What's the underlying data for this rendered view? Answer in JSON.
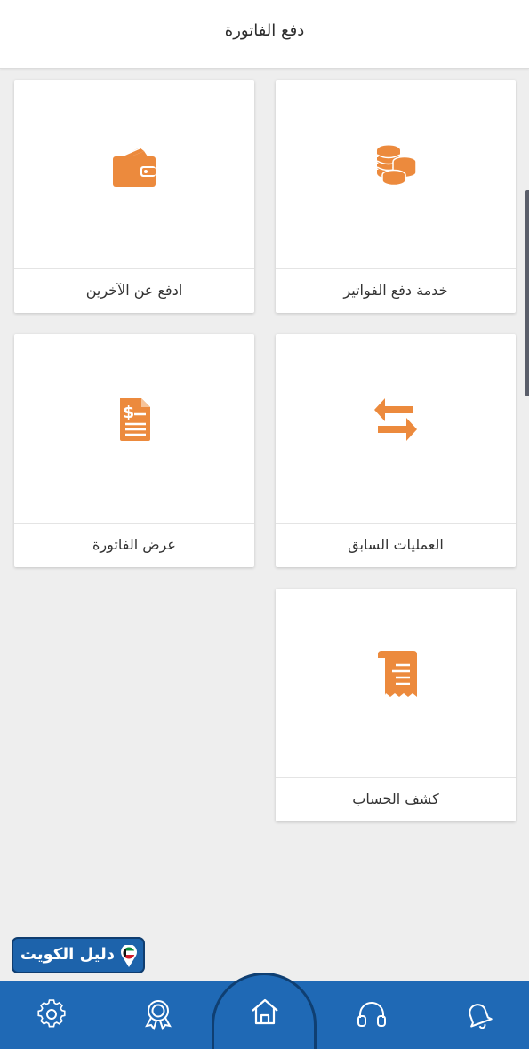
{
  "header": {
    "title": "دفع الفاتورة"
  },
  "cards": [
    {
      "id": "bill-payment-service",
      "label": "خدمة دفع الفواتير",
      "icon": "coins-icon"
    },
    {
      "id": "pay-for-others",
      "label": "ادفع عن الآخرين",
      "icon": "wallet-icon"
    },
    {
      "id": "previous-transactions",
      "label": "العمليات السابق",
      "icon": "transfer-arrows-icon"
    },
    {
      "id": "view-bill",
      "label": "عرض الفاتورة",
      "icon": "invoice-document-icon"
    },
    {
      "id": "account-statement",
      "label": "كشف الحساب",
      "icon": "receipt-icon"
    }
  ],
  "watermark": {
    "text": "دليل الكويت",
    "icon": "location-pin-icon"
  },
  "bottom_nav": {
    "items": [
      "settings-icon",
      "award-icon",
      "home-icon",
      "headset-icon",
      "bell-icon"
    ],
    "active": "home-icon"
  },
  "colors": {
    "accent": "#ec8a3d",
    "nav_bar": "#1f69b5",
    "background": "#eeeeee"
  }
}
